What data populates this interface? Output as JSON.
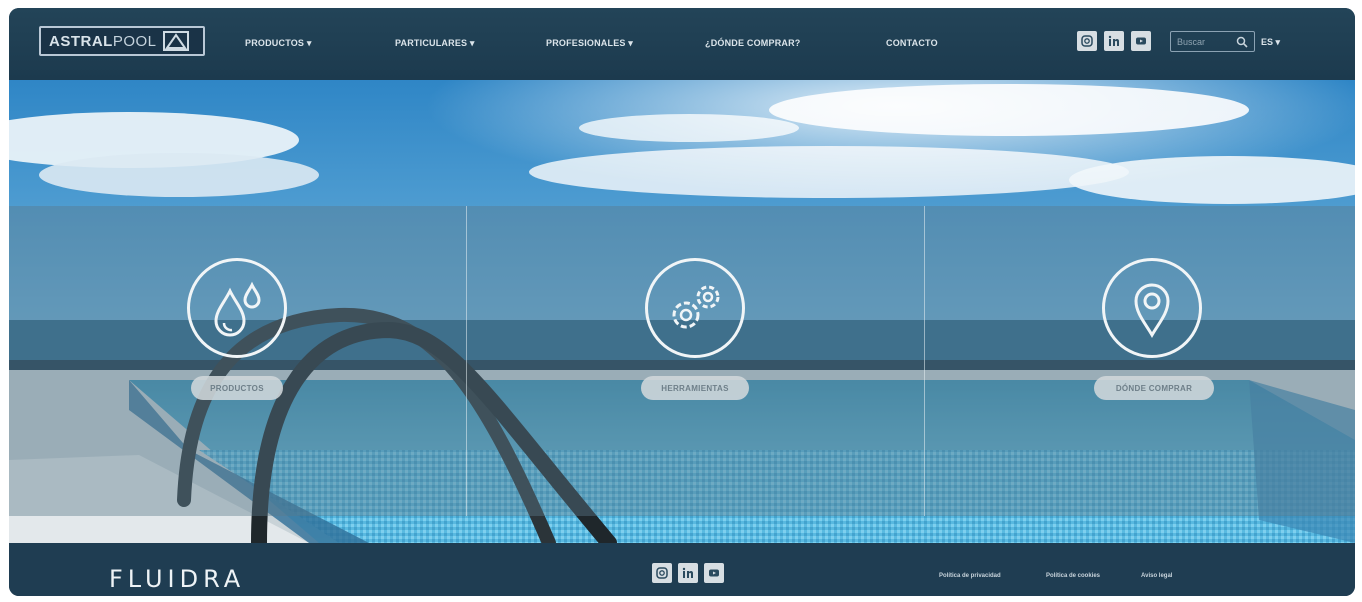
{
  "header": {
    "logo": {
      "strong": "ASTRAL",
      "light": "POOL"
    },
    "nav": [
      {
        "label": "PRODUCTOS ▾"
      },
      {
        "label": "PARTICULARES ▾"
      },
      {
        "label": "PROFESIONALES ▾"
      },
      {
        "label": "¿DÓNDE COMPRAR?"
      },
      {
        "label": "CONTACTO"
      }
    ],
    "social_icons": [
      "instagram-icon",
      "linkedin-icon",
      "youtube-icon"
    ],
    "search": {
      "placeholder": "Buscar"
    },
    "language": "ES ▾"
  },
  "hero": {
    "panels": [
      {
        "icon": "water-drops-icon",
        "label": "PRODUCTOS"
      },
      {
        "icon": "gears-icon",
        "label": "HERRAMIENTAS"
      },
      {
        "icon": "location-pin-icon",
        "label": "DÓNDE COMPRAR"
      }
    ]
  },
  "footer": {
    "brand": "FLUIDRA",
    "social_icons": [
      "instagram-icon",
      "linkedin-icon",
      "youtube-icon"
    ],
    "links": [
      {
        "label": "Política de privacidad"
      },
      {
        "label": "Política de cookies"
      },
      {
        "label": "Aviso legal"
      }
    ]
  },
  "colors": {
    "nav_bg": "#1c3a4e",
    "footer_bg": "#1f3d52",
    "pill_bg": "#d0d7db",
    "sky": "#3f8fc8",
    "water": "#4fb0d8"
  }
}
